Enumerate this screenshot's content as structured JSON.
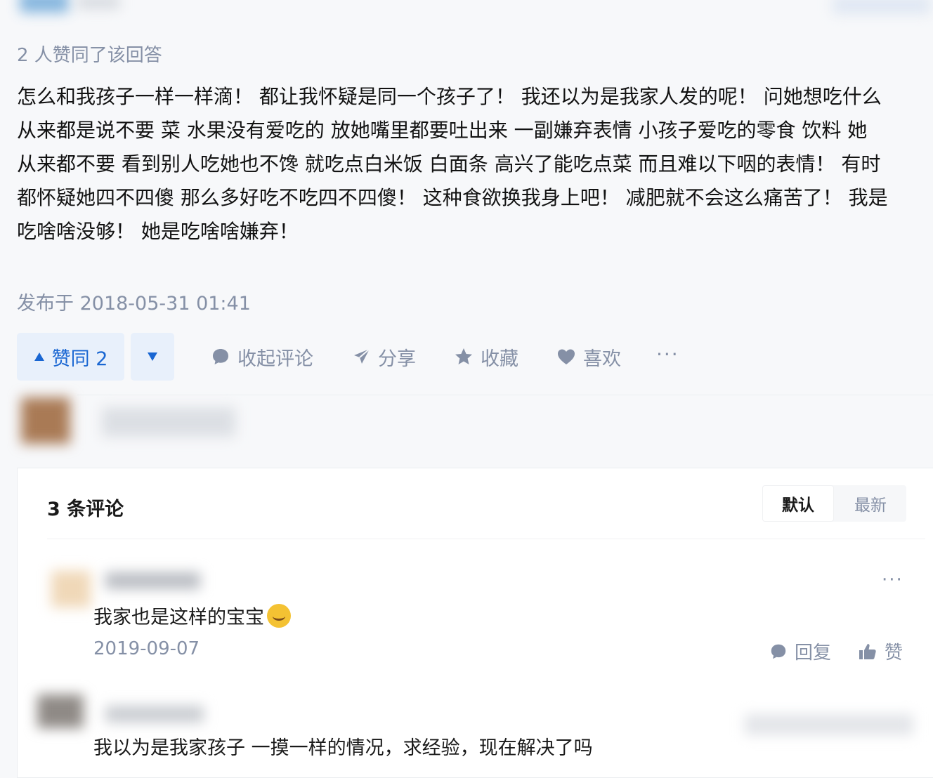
{
  "answer": {
    "vote_summary": "2 人赞同了该回答",
    "body_lines": [
      "怎么和我孩子一样一样滴！ 都让我怀疑是同一个孩子了！ 我还以为是我家人发的呢！ 问她想吃什么",
      "从来都是说不要 菜 水果没有爱吃的 放她嘴里都要吐出来 一副嫌弃表情 小孩子爱吃的零食 饮料 她",
      "从来都不要 看到别人吃她也不馋 就吃点白米饭 白面条 高兴了能吃点菜 而且难以下咽的表情！ 有时",
      "都怀疑她四不四傻 那么多好吃不吃四不四傻！ 这种食欲换我身上吧！ 减肥就不会这么痛苦了！ 我是",
      "吃啥啥没够！ 她是吃啥啥嫌弃！"
    ],
    "published": "发布于 2018-05-31 01:41"
  },
  "actions": {
    "vote_up_label": "赞同 2",
    "collapse_comments_label": "收起评论",
    "share_label": "分享",
    "favorite_label": "收藏",
    "like_label": "喜欢",
    "more_label": "···"
  },
  "comments": {
    "count_label": "3 条评论",
    "sort_default": "默认",
    "sort_latest": "最新",
    "items": [
      {
        "text": "我家也是这样的宝宝",
        "date": "2019-09-07",
        "reply_label": "回复",
        "like_label": "赞",
        "more_label": "···"
      },
      {
        "text": "我以为是我家孩子 一摸一样的情况，求经验，现在解决了吗"
      }
    ]
  },
  "icons": {
    "vote_up": "triangle-up-icon",
    "vote_down": "triangle-down-icon",
    "comment": "comment-bubble-icon",
    "share": "paper-plane-icon",
    "favorite": "star-icon",
    "like": "heart-icon",
    "reply": "comment-bubble-icon",
    "thumb": "thumbs-up-icon"
  },
  "colors": {
    "accent": "#1966d2",
    "muted": "#8590a6",
    "vote_bg": "#e8f0fb"
  }
}
